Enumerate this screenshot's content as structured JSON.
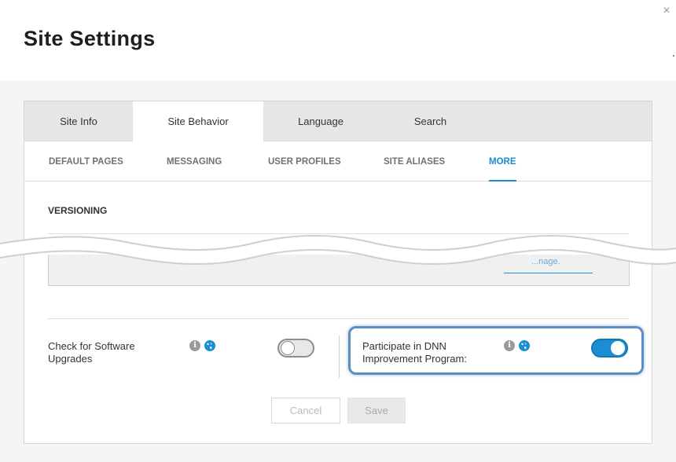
{
  "dialog": {
    "title": "Site Settings",
    "close_icon": "close-icon",
    "close_glyph": "×"
  },
  "tabs": [
    {
      "label": "Site Info",
      "active": false
    },
    {
      "label": "Site Behavior",
      "active": true
    },
    {
      "label": "Language",
      "active": false
    },
    {
      "label": "Search",
      "active": false
    }
  ],
  "subtabs": [
    {
      "label": "DEFAULT PAGES",
      "active": false
    },
    {
      "label": "MESSAGING",
      "active": false
    },
    {
      "label": "USER PROFILES",
      "active": false
    },
    {
      "label": "SITE ALIASES",
      "active": false
    },
    {
      "label": "MORE",
      "active": true
    }
  ],
  "section": {
    "title": "VERSIONING",
    "partial_button_text": "...nage."
  },
  "settings": {
    "software_upgrades": {
      "label": "Check for Software Upgrades",
      "info_glyph": "i",
      "enabled": false
    },
    "dnn_improvement": {
      "label": "Participate in DNN Improvement Program:",
      "info_glyph": "i",
      "enabled": true
    }
  },
  "buttons": {
    "cancel": "Cancel",
    "save": "Save"
  },
  "colors": {
    "accent": "#1a8ed1",
    "highlight": "#5a8fc6",
    "tab_bar": "#e6e6e6"
  }
}
